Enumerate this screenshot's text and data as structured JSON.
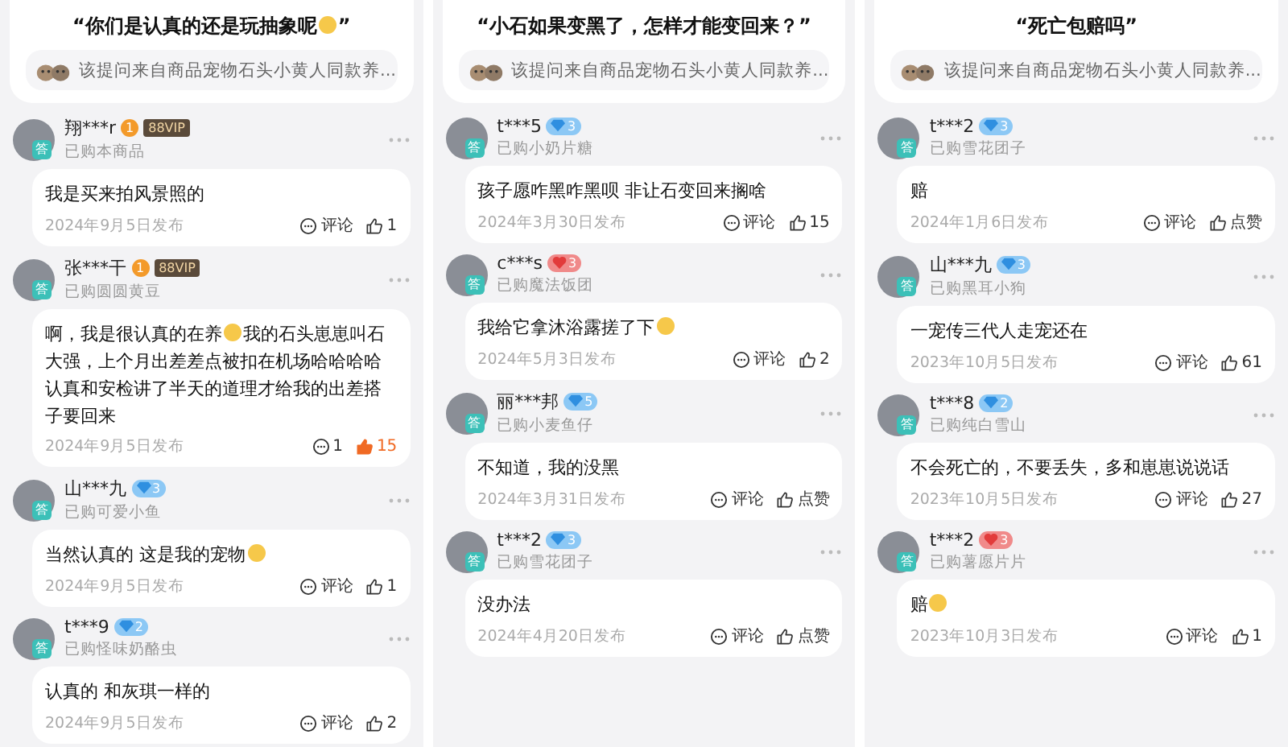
{
  "panels": [
    {
      "question": {
        "segments": [
          {
            "kind": "text",
            "text": "“你们是认真的还是玩抽象呢"
          },
          {
            "kind": "emoji"
          },
          {
            "kind": "text",
            "text": "”"
          }
        ],
        "source": "该提问来自商品宠物石头小黄人同款养..."
      },
      "answers": [
        {
          "user": "翔***r",
          "badges": [
            {
              "kind": "level",
              "text": "1"
            },
            {
              "kind": "vip",
              "text": "88VIP"
            }
          ],
          "tag": "答",
          "bought": "已购本商品",
          "segments": [
            {
              "kind": "text",
              "text": "我是买来拍风景照的"
            }
          ],
          "date": "2024年9月5日发布",
          "comment": "评论",
          "like": "1",
          "liked": false
        },
        {
          "user": "张***干",
          "badges": [
            {
              "kind": "level",
              "text": "1"
            },
            {
              "kind": "vip",
              "text": "88VIP"
            }
          ],
          "tag": "答",
          "bought": "已购圆圆黄豆",
          "segments": [
            {
              "kind": "text",
              "text": "啊，我是很认真的在养"
            },
            {
              "kind": "emoji"
            },
            {
              "kind": "text",
              "text": "我的石头崽崽叫石大强，上个月出差差点被扣在机场哈哈哈哈认真和安检讲了半天的道理才给我的出差搭子要回来"
            }
          ],
          "date": "2024年9月5日发布",
          "comment": "1",
          "like": "15",
          "liked": true
        },
        {
          "user": "山***九",
          "badges": [
            {
              "kind": "diamond",
              "text": "3"
            }
          ],
          "tag": "答",
          "bought": "已购可爱小鱼",
          "segments": [
            {
              "kind": "text",
              "text": "当然认真的  这是我的宠物"
            },
            {
              "kind": "emoji"
            }
          ],
          "date": "2024年9月5日发布",
          "comment": "评论",
          "like": "1",
          "liked": false
        },
        {
          "user": "t***9",
          "badges": [
            {
              "kind": "diamond",
              "text": "2"
            }
          ],
          "tag": "答",
          "bought": "已购怪味奶酪虫",
          "segments": [
            {
              "kind": "text",
              "text": "认真的 和灰琪一样的"
            }
          ],
          "date": "2024年9月5日发布",
          "comment": "评论",
          "like": "2",
          "liked": false
        }
      ]
    },
    {
      "question": {
        "segments": [
          {
            "kind": "text",
            "text": "“小石如果变黑了，怎样才能变回来？”"
          }
        ],
        "source": "该提问来自商品宠物石头小黄人同款养..."
      },
      "answers": [
        {
          "user": "t***5",
          "badges": [
            {
              "kind": "diamond",
              "text": "3"
            }
          ],
          "tag": "答",
          "bought": "已购小奶片糖",
          "segments": [
            {
              "kind": "text",
              "text": "孩子愿咋黑咋黑呗 非让石变回来搁啥"
            }
          ],
          "date": "2024年3月30日发布",
          "comment": "评论",
          "like": "15",
          "liked": false
        },
        {
          "user": "c***s",
          "badges": [
            {
              "kind": "heart",
              "text": "3"
            }
          ],
          "tag": "答",
          "bought": "已购魔法饭团",
          "segments": [
            {
              "kind": "text",
              "text": "我给它拿沐浴露搓了下"
            },
            {
              "kind": "emoji"
            }
          ],
          "date": "2024年5月3日发布",
          "comment": "评论",
          "like": "2",
          "liked": false
        },
        {
          "user": "丽***邦",
          "badges": [
            {
              "kind": "diamond",
              "text": "5"
            }
          ],
          "tag": "答",
          "bought": "已购小麦鱼仔",
          "segments": [
            {
              "kind": "text",
              "text": "不知道，我的没黑"
            }
          ],
          "date": "2024年3月31日发布",
          "comment": "评论",
          "like": "点赞",
          "liked": false
        },
        {
          "user": "t***2",
          "badges": [
            {
              "kind": "diamond",
              "text": "3"
            }
          ],
          "tag": "答",
          "bought": "已购雪花团子",
          "segments": [
            {
              "kind": "text",
              "text": "没办法"
            }
          ],
          "date": "2024年4月20日发布",
          "comment": "评论",
          "like": "点赞",
          "liked": false
        }
      ]
    },
    {
      "question": {
        "segments": [
          {
            "kind": "text",
            "text": "“死亡包赔吗”"
          }
        ],
        "source": "该提问来自商品宠物石头小黄人同款养..."
      },
      "answers": [
        {
          "user": "t***2",
          "badges": [
            {
              "kind": "diamond",
              "text": "3"
            }
          ],
          "tag": "答",
          "bought": "已购雪花团子",
          "segments": [
            {
              "kind": "text",
              "text": "赔"
            }
          ],
          "date": "2024年1月6日发布",
          "comment": "评论",
          "like": "点赞",
          "liked": false
        },
        {
          "user": "山***九",
          "badges": [
            {
              "kind": "diamond",
              "text": "3"
            }
          ],
          "tag": "答",
          "bought": "已购黑耳小狗",
          "segments": [
            {
              "kind": "text",
              "text": "一宠传三代人走宠还在"
            }
          ],
          "date": "2023年10月5日发布",
          "comment": "评论",
          "like": "61",
          "liked": false
        },
        {
          "user": "t***8",
          "badges": [
            {
              "kind": "diamond",
              "text": "2"
            }
          ],
          "tag": "答",
          "bought": "已购纯白雪山",
          "segments": [
            {
              "kind": "text",
              "text": "不会死亡的，不要丢失，多和崽崽说说话"
            }
          ],
          "date": "2023年10月5日发布",
          "comment": "评论",
          "like": "27",
          "liked": false
        },
        {
          "user": "t***2",
          "badges": [
            {
              "kind": "heart",
              "text": "3"
            }
          ],
          "tag": "答",
          "bought": "已购薯愿片片",
          "segments": [
            {
              "kind": "text",
              "text": "赔"
            },
            {
              "kind": "emoji"
            }
          ],
          "date": "2023年10月3日发布",
          "comment": "评论",
          "like": "1",
          "liked": false
        }
      ]
    }
  ]
}
